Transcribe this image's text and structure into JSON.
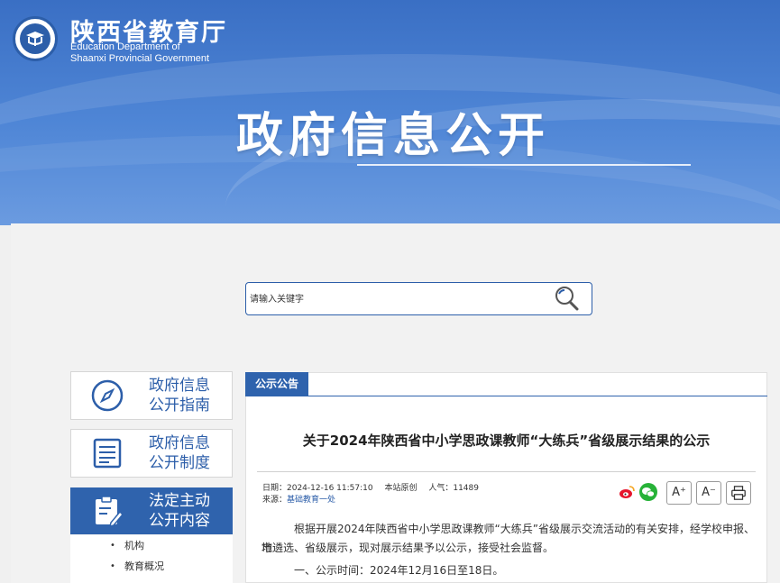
{
  "header": {
    "logo_cn": "陕西省教育厅",
    "logo_en_line1": "Education Department of",
    "logo_en_line2": "Shaanxi Provincial Government",
    "banner_title": "政府信息公开"
  },
  "search": {
    "placeholder": "请输入关键字"
  },
  "sidebar": {
    "items": [
      {
        "line1": "政府信息",
        "line2": "公开指南",
        "icon": "compass-icon"
      },
      {
        "line1": "政府信息",
        "line2": "公开制度",
        "icon": "list-document-icon"
      },
      {
        "line1": "法定主动",
        "line2": "公开内容",
        "icon": "clipboard-edit-icon"
      }
    ],
    "sub_items": [
      "机构",
      "教育概况"
    ]
  },
  "article": {
    "section_tag": "公示公告",
    "title": "关于2024年陕西省中小学思政课教师“大练兵”省级展示结果的公示",
    "date_label": "日期：2024-12-16 11:57:10",
    "origin_label": "本站原创",
    "views_label": "人气：11489",
    "source_label": "来源：",
    "source_value": "基础教育一处",
    "font_increase": "A⁺",
    "font_decrease": "A⁻",
    "para1_line1": "根据开展2024年陕西省中小学思政课教师“大练兵”省级展示交流活动的有关安排，经学校申报、地",
    "para1_line2": "市遴选、省级展示，现对展示结果予以公示，接受社会监督。",
    "para2": "一、公示时间：2024年12月16日至18日。"
  },
  "colors": {
    "brand_blue": "#2f63ad",
    "banner_blue": "#4f86d6",
    "wechat_green": "#27b238",
    "weibo_red": "#e6162d"
  }
}
